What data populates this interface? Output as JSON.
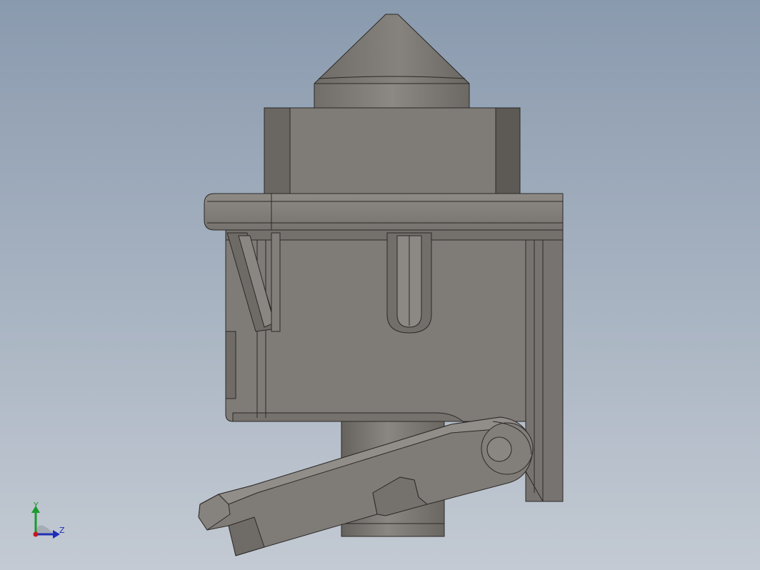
{
  "viewport": {
    "background_top": "#8b9bb0",
    "background_bottom": "#c2c9d3",
    "model": {
      "body_color": "#7f7b77",
      "shadow_color": "#5b5854",
      "highlight_color": "#9a9691",
      "edge_color": "#2a2826"
    }
  },
  "triad": {
    "y_label": "Y",
    "z_label": "Z",
    "y_color": "#1a9a2a",
    "z_color": "#1f2fb8",
    "origin_color": "#c81818"
  }
}
